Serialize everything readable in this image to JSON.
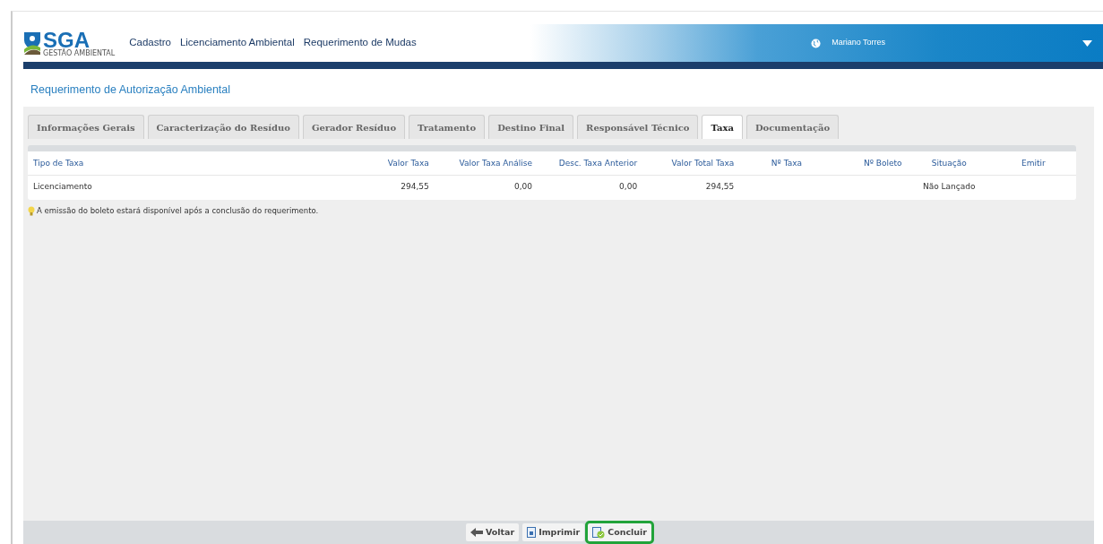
{
  "header": {
    "logo": {
      "title": "SGA",
      "subtitle": "GESTÃO AMBIENTAL"
    },
    "nav": [
      "Cadastro",
      "Licenciamento Ambiental",
      "Requerimento de Mudas"
    ],
    "user": "Mariano Torres"
  },
  "page_title": "Requerimento de Autorização Ambiental",
  "tabs": [
    {
      "label": "Informações Gerais",
      "selected": false
    },
    {
      "label": "Caracterização do Resíduo",
      "selected": false
    },
    {
      "label": "Gerador Resíduo",
      "selected": false
    },
    {
      "label": "Tratamento",
      "selected": false
    },
    {
      "label": "Destino Final",
      "selected": false
    },
    {
      "label": "Responsável Técnico",
      "selected": false
    },
    {
      "label": "Taxa",
      "selected": true
    },
    {
      "label": "Documentação",
      "selected": false
    }
  ],
  "table": {
    "columns": [
      "Tipo de Taxa",
      "Valor Taxa",
      "Valor Taxa Análise",
      "Desc. Taxa Anterior",
      "Valor Total Taxa",
      "Nº Taxa",
      "Nº Boleto",
      "Situação",
      "Emitir"
    ],
    "rows": [
      [
        "Licenciamento",
        "294,55",
        "0,00",
        "0,00",
        "294,55",
        "",
        "",
        "Não Lançado",
        ""
      ]
    ]
  },
  "note": "A emissão do boleto estará disponível após a conclusão do requerimento.",
  "buttons": [
    {
      "label": "Voltar",
      "kind": "back",
      "highlighted": false
    },
    {
      "label": "Imprimir",
      "kind": "print",
      "highlighted": false
    },
    {
      "label": "Concluir",
      "kind": "finish",
      "highlighted": true
    }
  ]
}
